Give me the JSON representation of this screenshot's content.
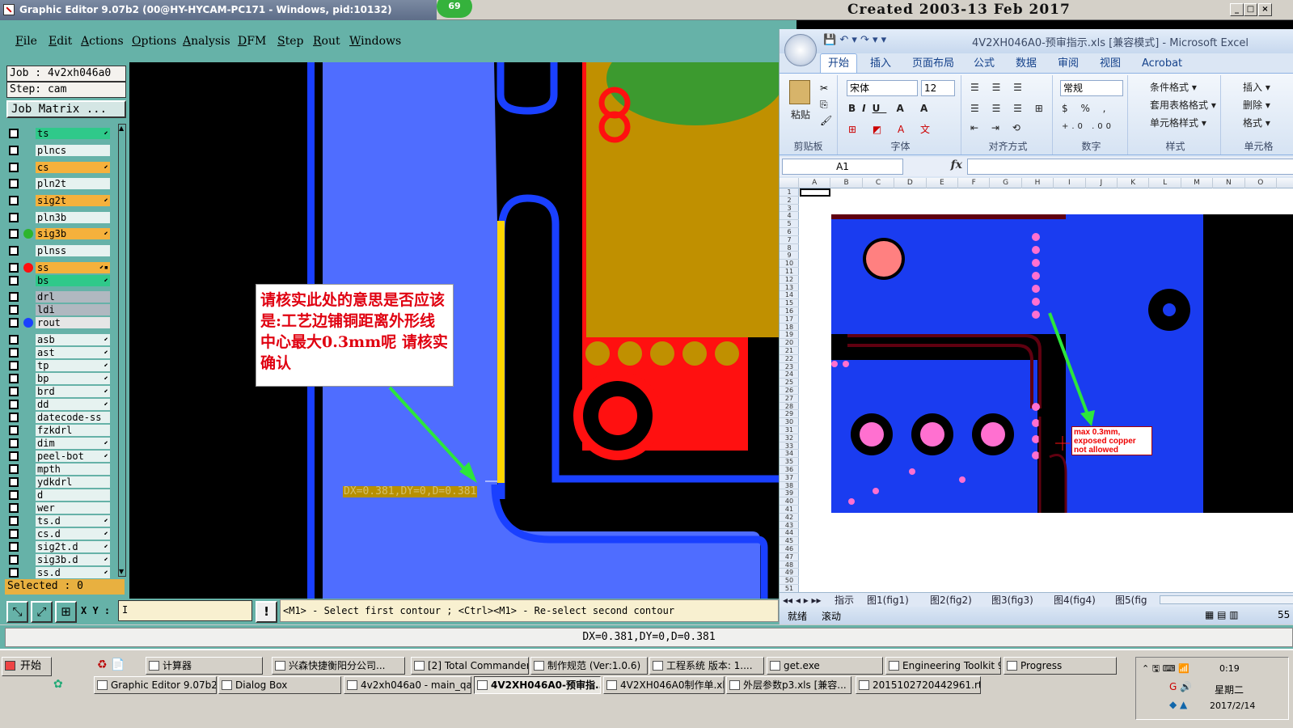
{
  "ge": {
    "title": "Graphic Editor 9.07b2 (00@HY-HYCAM-PC171 - Windows, pid:10132)",
    "badge": "69",
    "bg_date": "Created 2003-13 Feb 2017",
    "menu": [
      "File",
      "Edit",
      "Actions",
      "Options",
      "Analysis",
      "DFM",
      "Step",
      "Rout",
      "Windows"
    ],
    "job": "Job : 4v2xh046a0",
    "step": "Step: cam",
    "job_matrix": "Job Matrix ...",
    "selected": "Selected : 0",
    "xy_label": "X Y :",
    "xy_value": "I",
    "status_text": "<M1> - Select first contour ; <Ctrl><M1> - Re-select second contour",
    "measure": "DX=0.381,DY=0,D=0.381",
    "measure_bar": "DX=0.381,DY=0,D=0.381",
    "note": "请核实此处的意思是否应该是:工艺边铺铜距离外形线中心最大0.3mm呢 请核实确认"
  },
  "layers": [
    {
      "name": "ts",
      "color": "#2fc98a",
      "dot": "",
      "tick": "⬋"
    },
    {
      "name": "plncs",
      "color": "#e6f2f0",
      "dot": "",
      "tick": ""
    },
    {
      "name": "cs",
      "color": "#f5b13c",
      "dot": "",
      "tick": "⬋"
    },
    {
      "name": "pln2t",
      "color": "#e6f2f0",
      "dot": "",
      "tick": ""
    },
    {
      "name": "sig2t",
      "color": "#f5b13c",
      "dot": "",
      "tick": "⬋"
    },
    {
      "name": "pln3b",
      "color": "#e6f2f0",
      "dot": "",
      "tick": ""
    },
    {
      "name": "sig3b",
      "color": "#f5b13c",
      "dot": "#2db52d",
      "tick": "⬋"
    },
    {
      "name": "plnss",
      "color": "#e6f2f0",
      "dot": "",
      "tick": ""
    },
    {
      "name": "ss",
      "color": "#f5b13c",
      "dot": "#ff1010",
      "tick": "⬋▪"
    },
    {
      "name": "bs",
      "color": "#2fc98a",
      "dot": "",
      "tick": "⬋"
    },
    {
      "name": "drl",
      "color": "#b0b8c0",
      "dot": "",
      "tick": ""
    },
    {
      "name": "ldi",
      "color": "#b0b8c0",
      "dot": "",
      "tick": ""
    },
    {
      "name": "rout",
      "color": "#e6e6e6",
      "dot": "#1a40ff",
      "tick": ""
    },
    {
      "name": "asb",
      "color": "#e6f2f0",
      "dot": "",
      "tick": "⬋"
    },
    {
      "name": "ast",
      "color": "#e6f2f0",
      "dot": "",
      "tick": "⬋"
    },
    {
      "name": "tp",
      "color": "#e6f2f0",
      "dot": "",
      "tick": "⬋"
    },
    {
      "name": "bp",
      "color": "#e6f2f0",
      "dot": "",
      "tick": "⬋"
    },
    {
      "name": "brd",
      "color": "#e6f2f0",
      "dot": "",
      "tick": "⬋"
    },
    {
      "name": "dd",
      "color": "#e6f2f0",
      "dot": "",
      "tick": "⬋"
    },
    {
      "name": "datecode-ss",
      "color": "#e6f2f0",
      "dot": "",
      "tick": ""
    },
    {
      "name": "fzkdrl",
      "color": "#e6f2f0",
      "dot": "",
      "tick": ""
    },
    {
      "name": "dim",
      "color": "#e6f2f0",
      "dot": "",
      "tick": "⬋"
    },
    {
      "name": "peel-bot",
      "color": "#e6f2f0",
      "dot": "",
      "tick": "⬋"
    },
    {
      "name": "mpth",
      "color": "#e6f2f0",
      "dot": "",
      "tick": ""
    },
    {
      "name": "ydkdrl",
      "color": "#e6f2f0",
      "dot": "",
      "tick": ""
    },
    {
      "name": "d",
      "color": "#e6f2f0",
      "dot": "",
      "tick": ""
    },
    {
      "name": "wer",
      "color": "#e6f2f0",
      "dot": "",
      "tick": ""
    },
    {
      "name": "ts.d",
      "color": "#e6f2f0",
      "dot": "",
      "tick": "⬋"
    },
    {
      "name": "cs.d",
      "color": "#e6f2f0",
      "dot": "",
      "tick": "⬋"
    },
    {
      "name": "sig2t.d",
      "color": "#e6f2f0",
      "dot": "",
      "tick": "⬋"
    },
    {
      "name": "sig3b.d",
      "color": "#e6f2f0",
      "dot": "",
      "tick": "⬋"
    },
    {
      "name": "ss.d",
      "color": "#e6f2f0",
      "dot": "",
      "tick": "⬋"
    }
  ],
  "excel": {
    "title": "4V2XH046A0-预审指示.xls  [兼容模式] - Microsoft Excel",
    "tabs": [
      "开始",
      "插入",
      "页面布局",
      "公式",
      "数据",
      "审阅",
      "视图",
      "Acrobat"
    ],
    "groups": [
      "剪贴板",
      "字体",
      "对齐方式",
      "数字",
      "样式",
      "单元格"
    ],
    "paste": "粘贴",
    "font": "宋体",
    "size": "12",
    "numfmt": "常规",
    "style_buttons": [
      "条件格式 ▾",
      "套用表格格式 ▾",
      "单元格样式 ▾"
    ],
    "cell_buttons": [
      "插入 ▾",
      "删除 ▾",
      "格式 ▾"
    ],
    "namebox": "A1",
    "fx": "fx",
    "columns": [
      "A",
      "B",
      "C",
      "D",
      "E",
      "F",
      "G",
      "H",
      "I",
      "J",
      "K",
      "L",
      "M",
      "N",
      "O"
    ],
    "annotation": "max 0.3mm, exposed copper not allowed",
    "sheets": [
      "指示",
      "图1(fig1)",
      "图2(fig2)",
      "图3(fig3)",
      "图4(fig4)",
      "图5(fig"
    ],
    "status": [
      "就绪",
      "滚动"
    ],
    "zoom": "55"
  },
  "taskbar": {
    "start": "开始",
    "row1": [
      "计算器",
      "兴森快捷衡阳分公司...",
      "[2] Total Commander ...",
      "制作规范 (Ver:1.0.6)",
      "工程系统  版本: 1....",
      "get.exe",
      "Engineering Toolkit 9....",
      "Progress"
    ],
    "row2": [
      "Graphic Editor 9.07b2 (0...",
      "Dialog Box",
      "4v2xh046a0 - main_qa",
      "4V2XH046A0-预审指...",
      "4V2XH046A0制作单.xls ...",
      "外层参数p3.xls [兼容...",
      "201510272044296​1.rtf [..."
    ],
    "time": "0:19",
    "weekday": "星期二",
    "date": "2017/2/14"
  }
}
